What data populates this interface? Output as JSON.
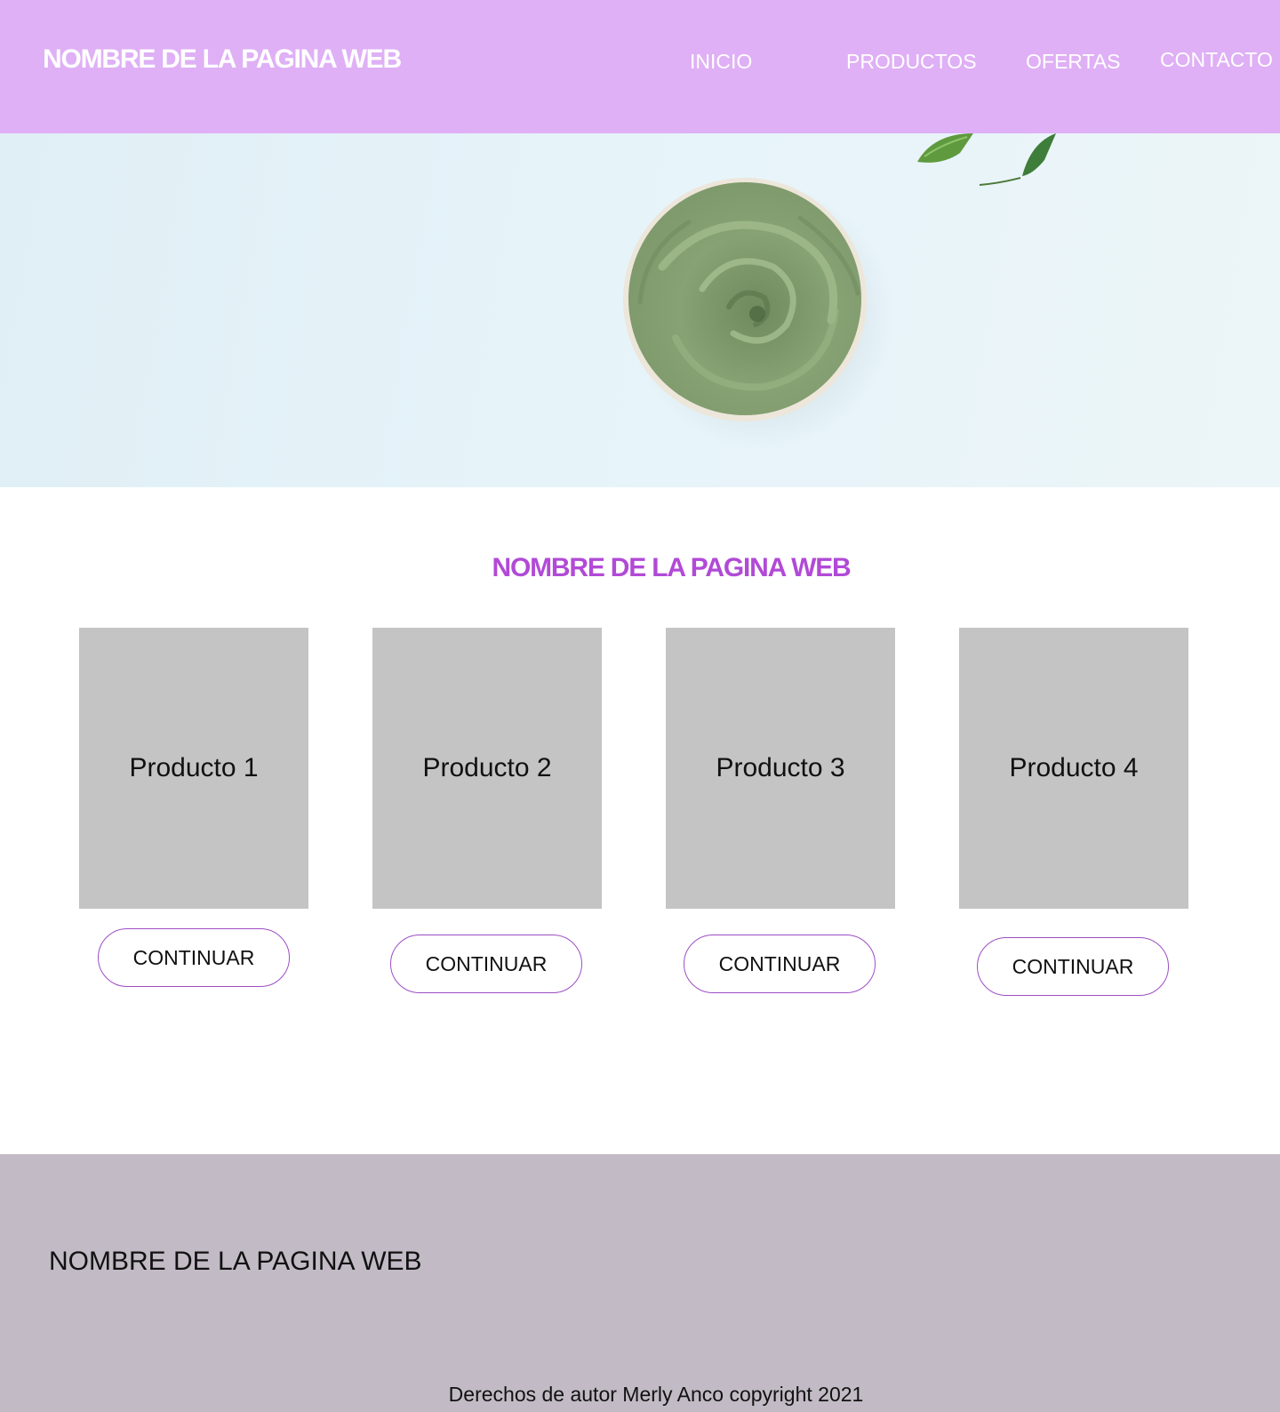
{
  "header": {
    "brand": "NOMBRE DE LA PAGINA WEB",
    "nav": [
      "INICIO",
      "PRODUCTOS",
      "OFERTAS",
      "CONTACTO"
    ]
  },
  "hero": {
    "image": "green-clay-mask-bowl-with-leaves"
  },
  "main": {
    "title": "NOMBRE DE LA PAGINA WEB",
    "products": [
      {
        "name": "Producto 1",
        "button": "CONTINUAR"
      },
      {
        "name": "Producto 2",
        "button": "CONTINUAR"
      },
      {
        "name": "Producto 3",
        "button": "CONTINUAR"
      },
      {
        "name": "Producto 4",
        "button": "CONTINUAR"
      }
    ]
  },
  "footer": {
    "brand": "NOMBRE DE LA PAGINA WEB",
    "copyright": "Derechos de autor Merly Anco copyright 2021"
  },
  "colors": {
    "header_bg": "#dfb0f5",
    "accent": "#b14ad6",
    "card_bg": "#c4c4c4",
    "button_border": "#9d4ec4",
    "footer_bg": "#c2bbc5"
  }
}
